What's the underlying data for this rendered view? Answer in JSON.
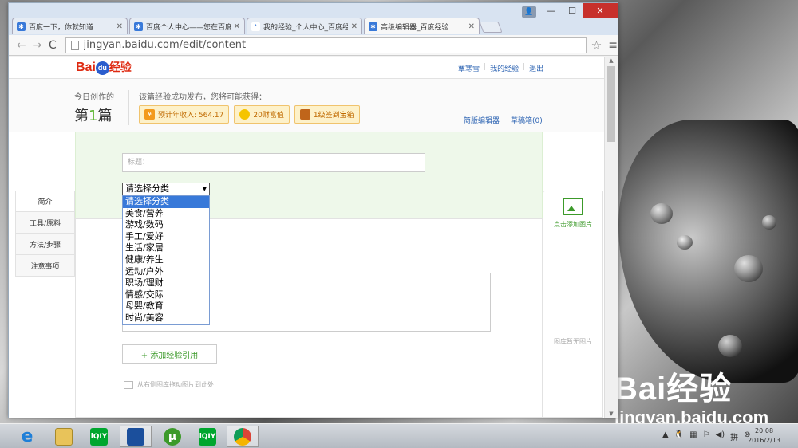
{
  "window": {
    "tabs": [
      {
        "label": "百度一下，你就知道",
        "fav": "paw-icon"
      },
      {
        "label": "百度个人中心——您在百度",
        "fav": "paw-icon"
      },
      {
        "label": "我的经验_个人中心_百度经验",
        "fav": "paw-icon"
      },
      {
        "label": "高级编辑器_百度经验",
        "fav": "paw-icon",
        "active": true
      }
    ],
    "controls": {
      "user": "👤",
      "minimize": "—",
      "maximize": "☐",
      "close": "✕"
    }
  },
  "toolbar": {
    "back": "←",
    "forward": "→",
    "reload": "C",
    "url": "jingyan.baidu.com/edit/content",
    "star": "☆",
    "menu": "≡"
  },
  "header": {
    "logo": {
      "bai": "Bai",
      "du": "du",
      "jingyan": "经验"
    },
    "nav": [
      "蕈寒雪",
      "我的经验",
      "退出"
    ]
  },
  "create": {
    "today_label": "今日创作的",
    "count_prefix": "第",
    "count_num": "1",
    "count_suffix": "篇",
    "rewards_title": "该篇经验成功发布，您将可能获得：",
    "badges": [
      {
        "icon": "piggy-bank-icon",
        "text": "预计年收入: 564.17"
      },
      {
        "icon": "coin-icon",
        "text": "20财富值"
      },
      {
        "icon": "treasure-box-icon",
        "text": "1级签到宝箱"
      }
    ],
    "editor_links": [
      "简版编辑器",
      "草稿箱(0)"
    ]
  },
  "form": {
    "title_placeholder": "标题：",
    "category": {
      "selected": "请选择分类",
      "options": [
        "请选择分类",
        "美食/营养",
        "游戏/数码",
        "手工/爱好",
        "生活/家居",
        "健康/养生",
        "运动/户外",
        "职场/理财",
        "情感/交际",
        "母婴/教育",
        "时尚/美容"
      ]
    },
    "add_reference": "+ 添加经验引用",
    "drag_hint": "从右侧图库拖动图片到此处"
  },
  "leftnav": [
    "简介",
    "工具/原料",
    "方法/步骤",
    "注意事项"
  ],
  "rightpanel": {
    "add_image": "点击添加图片",
    "no_image": "图库暂无图片"
  },
  "watermark": {
    "brand": "Bai经验",
    "url": "jingyan.baidu.com"
  },
  "taskbar": {
    "apps": [
      {
        "icon": "internet-explorer-icon",
        "label": "e"
      },
      {
        "icon": "file-explorer-icon",
        "label": ""
      },
      {
        "icon": "iqiyi-icon",
        "label": "iQIY"
      },
      {
        "icon": "calculator-icon",
        "label": ""
      },
      {
        "icon": "utorrent-icon",
        "label": "µ"
      },
      {
        "icon": "iqiyi-icon",
        "label": "iQIY"
      },
      {
        "icon": "chrome-icon",
        "label": ""
      }
    ],
    "tray": [
      "▲",
      "🐧",
      "▦",
      "⚐",
      "◀)",
      "拼",
      "⊗"
    ],
    "time": "20:08",
    "date": "2016/2/13"
  }
}
